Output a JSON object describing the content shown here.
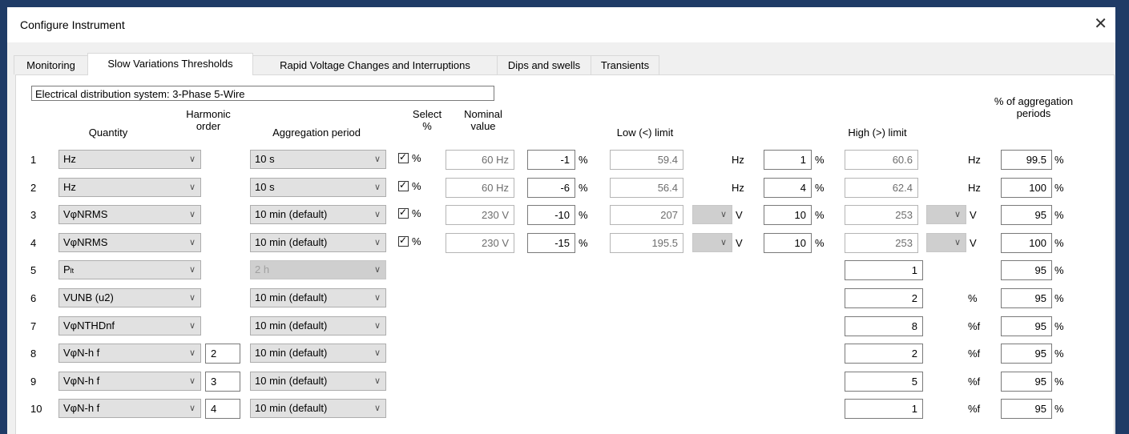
{
  "window": {
    "title": "Configure Instrument",
    "close_label": "✕"
  },
  "tabs": [
    {
      "label": "Monitoring",
      "active": false
    },
    {
      "label": "Slow Variations Thresholds",
      "active": true
    },
    {
      "label": "Rapid Voltage Changes and Interruptions",
      "active": false
    },
    {
      "label": "Dips and swells",
      "active": false
    },
    {
      "label": "Transients",
      "active": false
    }
  ],
  "system_label": "Electrical distribution system: 3-Phase 5-Wire",
  "headers": {
    "quantity": "Quantity",
    "harmonic_order": "Harmonic order",
    "aggregation_period": "Aggregation period",
    "select_percent": "Select %",
    "nominal_value": "Nominal value",
    "low_limit": "Low (<) limit",
    "high_limit": "High (>) limit",
    "percent_aggregation": "% of aggregation periods"
  },
  "rows": [
    {
      "num": "1",
      "quantity": "Hz",
      "harmonic": "",
      "aggregation": "10 s",
      "agg_disabled": false,
      "select": true,
      "select_label": "%",
      "nominal": "60 Hz",
      "low_pct": "-1",
      "low_val": "59.4",
      "low_unit": "Hz",
      "low_unit_combo": false,
      "high_pct": "1",
      "high_val": "60.6",
      "high_unit": "Hz",
      "high_unit_combo": false,
      "aggr_pct": "99.5"
    },
    {
      "num": "2",
      "quantity": "Hz",
      "harmonic": "",
      "aggregation": "10 s",
      "agg_disabled": false,
      "select": true,
      "select_label": "%",
      "nominal": "60 Hz",
      "low_pct": "-6",
      "low_val": "56.4",
      "low_unit": "Hz",
      "low_unit_combo": false,
      "high_pct": "4",
      "high_val": "62.4",
      "high_unit": "Hz",
      "high_unit_combo": false,
      "aggr_pct": "100"
    },
    {
      "num": "3",
      "quantity": "VφNRMS",
      "harmonic": "",
      "aggregation": "10 min (default)",
      "agg_disabled": false,
      "select": true,
      "select_label": "%",
      "nominal": "230 V",
      "low_pct": "-10",
      "low_val": "207",
      "low_unit": "V",
      "low_unit_combo": true,
      "high_pct": "10",
      "high_val": "253",
      "high_unit": "V",
      "high_unit_combo": true,
      "aggr_pct": "95"
    },
    {
      "num": "4",
      "quantity": "VφNRMS",
      "harmonic": "",
      "aggregation": "10 min (default)",
      "agg_disabled": false,
      "select": true,
      "select_label": "%",
      "nominal": "230 V",
      "low_pct": "-15",
      "low_val": "195.5",
      "low_unit": "V",
      "low_unit_combo": true,
      "high_pct": "10",
      "high_val": "253",
      "high_unit": "V",
      "high_unit_combo": true,
      "aggr_pct": "100"
    },
    {
      "num": "5",
      "quantity": "Plt",
      "harmonic": "",
      "aggregation": "2 h",
      "agg_disabled": true,
      "high_only": "1",
      "high_unit": "",
      "aggr_pct": "95"
    },
    {
      "num": "6",
      "quantity": "VUNB (u2)",
      "harmonic": "",
      "aggregation": "10 min (default)",
      "agg_disabled": false,
      "high_only": "2",
      "high_unit": "%",
      "aggr_pct": "95"
    },
    {
      "num": "7",
      "quantity": "VφNTHDnf",
      "harmonic": "",
      "aggregation": "10 min (default)",
      "agg_disabled": false,
      "high_only": "8",
      "high_unit": "%f",
      "aggr_pct": "95"
    },
    {
      "num": "8",
      "quantity": "VφN-h f",
      "harmonic": "2",
      "aggregation": "10 min (default)",
      "agg_disabled": false,
      "high_only": "2",
      "high_unit": "%f",
      "aggr_pct": "95"
    },
    {
      "num": "9",
      "quantity": "VφN-h f",
      "harmonic": "3",
      "aggregation": "10 min (default)",
      "agg_disabled": false,
      "high_only": "5",
      "high_unit": "%f",
      "aggr_pct": "95"
    },
    {
      "num": "10",
      "quantity": "VφN-h f",
      "harmonic": "4",
      "aggregation": "10 min (default)",
      "agg_disabled": false,
      "high_only": "1",
      "high_unit": "%f",
      "aggr_pct": "95"
    }
  ],
  "percent_sign": "%",
  "colors": {
    "background": "#1f3b66",
    "dialog": "#f0f0f0",
    "panel": "#ffffff"
  }
}
